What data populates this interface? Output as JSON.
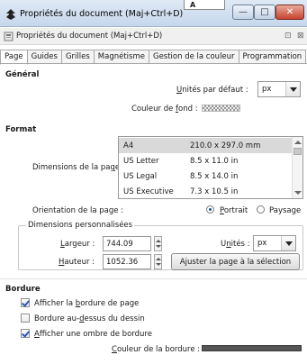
{
  "window": {
    "title": "Propriétés du document (Maj+Ctrl+D)",
    "ghost_tab": "A",
    "minimize_symbol": "—",
    "maximize_symbol": "□",
    "close_symbol": "✕"
  },
  "dock": {
    "title": "Propriétés du document (Maj+Ctrl+D)",
    "btn_a": "⊡",
    "btn_b": "⊠"
  },
  "tabs": [
    "Page",
    "Guides",
    "Grilles",
    "Magnétisme",
    "Gestion de la couleur",
    "Programmation"
  ],
  "general": {
    "section": "Général",
    "units_label_pre": "",
    "units_label_u": "U",
    "units_label_post": "nités par défaut :",
    "units_value": "px",
    "bg_label_pre": "Couleur de ",
    "bg_label_u": "f",
    "bg_label_post": "ond :"
  },
  "format": {
    "section": "Format",
    "dims_label_pre": "Dimensions de la pa",
    "dims_label_u": "g",
    "dims_label_post": "e :",
    "sizes": [
      {
        "name": "A4",
        "dims": "210.0 x 297.0 mm"
      },
      {
        "name": "US Letter",
        "dims": "8.5 x 11.0 in"
      },
      {
        "name": "US Legal",
        "dims": "8.5 x 14.0 in"
      },
      {
        "name": "US Executive",
        "dims": "7.3 x 10.5 in"
      }
    ],
    "orientation_label": "Orientation de la page :",
    "portrait_pre": "",
    "portrait_u": "P",
    "portrait_post": "ortrait",
    "landscape": "Paysage",
    "custom_legend": "Dimensions personnalisées",
    "width_label_pre": "",
    "width_label_u": "L",
    "width_label_post": "argeur :",
    "width_value": "744.09",
    "height_label_pre": "",
    "height_label_u": "H",
    "height_label_post": "auteur :",
    "height_value": "1052.36",
    "units_label_pre": "U",
    "units_label_u": "n",
    "units_label_post": "ités :",
    "units_value": "px",
    "fit_button": "Ajuster la page à la sélection"
  },
  "border": {
    "section": "Bordure",
    "show_border_pre": "Afficher la ",
    "show_border_u": "b",
    "show_border_post": "ordure de page",
    "border_top_pre": "Bordure au-",
    "border_top_u": "d",
    "border_top_post": "essus du dessin",
    "shadow_pre": "",
    "shadow_u": "A",
    "shadow_post": "fficher une ombre de bordure",
    "color_pre": "",
    "color_u": "C",
    "color_post": "ouleur de la bordure :",
    "color_value": "#555555"
  },
  "colors": {
    "close_button": "#c7432f",
    "accent": "#2e57b8"
  }
}
